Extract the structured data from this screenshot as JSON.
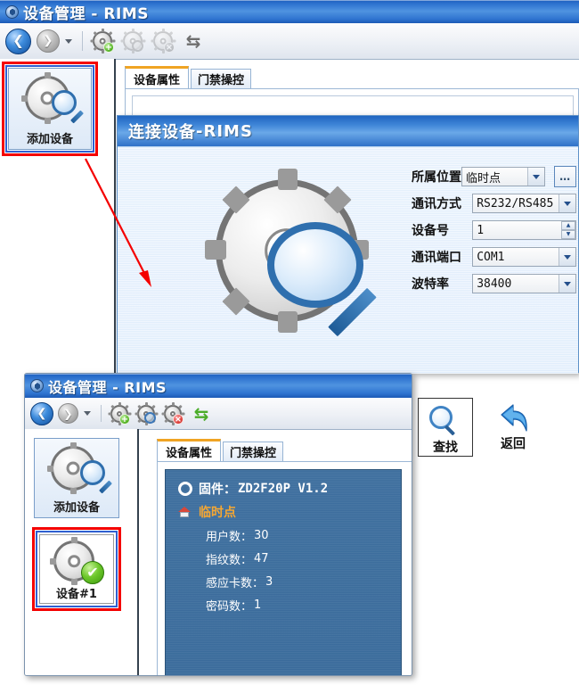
{
  "main_window": {
    "title_main": "设备管理",
    "title_sep": " - ",
    "title_sub": "RIMS",
    "toolbar": {
      "back": "back-arrow",
      "forward": "forward-arrow",
      "dropdown": "chevron-down-icon",
      "add_device": "add-device-gear-icon",
      "find_device": "find-device-gear-icon",
      "delete_device": "delete-device-gear-icon",
      "refresh": "refresh-icon"
    },
    "sidebar": {
      "items": [
        {
          "label": "添加设备",
          "icon": "gear-magnifier-icon",
          "selected": true,
          "highlight": "red"
        }
      ]
    },
    "tabs": [
      {
        "label": "设备属性",
        "active": true
      },
      {
        "label": "门禁操控",
        "active": false
      }
    ]
  },
  "dialog": {
    "title_main": "连接设备",
    "title_sep": " - ",
    "title_sub": "RIMS",
    "icon": "gear-magnifier-icon",
    "fields": [
      {
        "label": "所属位置",
        "value": "临时点",
        "control": "select",
        "has_browse": true
      },
      {
        "label": "通讯方式",
        "value": "RS232/RS485",
        "control": "select",
        "has_browse": false
      },
      {
        "label": "设备号",
        "value": "1",
        "control": "spinner",
        "has_browse": false
      },
      {
        "label": "通讯端口",
        "value": "COM1",
        "control": "select",
        "has_browse": false
      },
      {
        "label": "波特率",
        "value": "38400",
        "control": "select",
        "has_browse": false
      }
    ],
    "buttons": [
      {
        "label": "查找",
        "icon": "magnifier-icon",
        "focused": true
      },
      {
        "label": "返回",
        "icon": "back-curve-icon",
        "focused": false
      }
    ]
  },
  "inset_window": {
    "title_main": "设备管理",
    "title_sep": " - ",
    "title_sub": "RIMS",
    "toolbar": {
      "back": "back-arrow",
      "forward": "forward-arrow",
      "dropdown": "chevron-down-icon",
      "add_device": "add-device-gear-icon",
      "find_device": "find-device-gear-icon",
      "delete_device": "delete-device-gear-icon",
      "refresh": "refresh-icon"
    },
    "sidebar": {
      "items": [
        {
          "label": "添加设备",
          "icon": "gear-magnifier-icon",
          "selected": false,
          "highlight": "none"
        },
        {
          "label": "设备#1",
          "icon": "gear-check-icon",
          "selected": true,
          "highlight": "red"
        }
      ]
    },
    "tabs": [
      {
        "label": "设备属性",
        "active": true
      },
      {
        "label": "门禁操控",
        "active": false
      }
    ],
    "detail": {
      "firmware_label": "固件：",
      "firmware_value": "ZD2F20P V1.2",
      "location": "临时点",
      "stats": [
        {
          "label": "用户数：",
          "value": "30"
        },
        {
          "label": "指纹数：",
          "value": "47"
        },
        {
          "label": "感应卡数：",
          "value": "3"
        },
        {
          "label": "密码数：",
          "value": "1"
        }
      ]
    }
  },
  "annotations": {
    "highlight_color": "#f40000",
    "arrow": "red-pointer-arrow"
  }
}
